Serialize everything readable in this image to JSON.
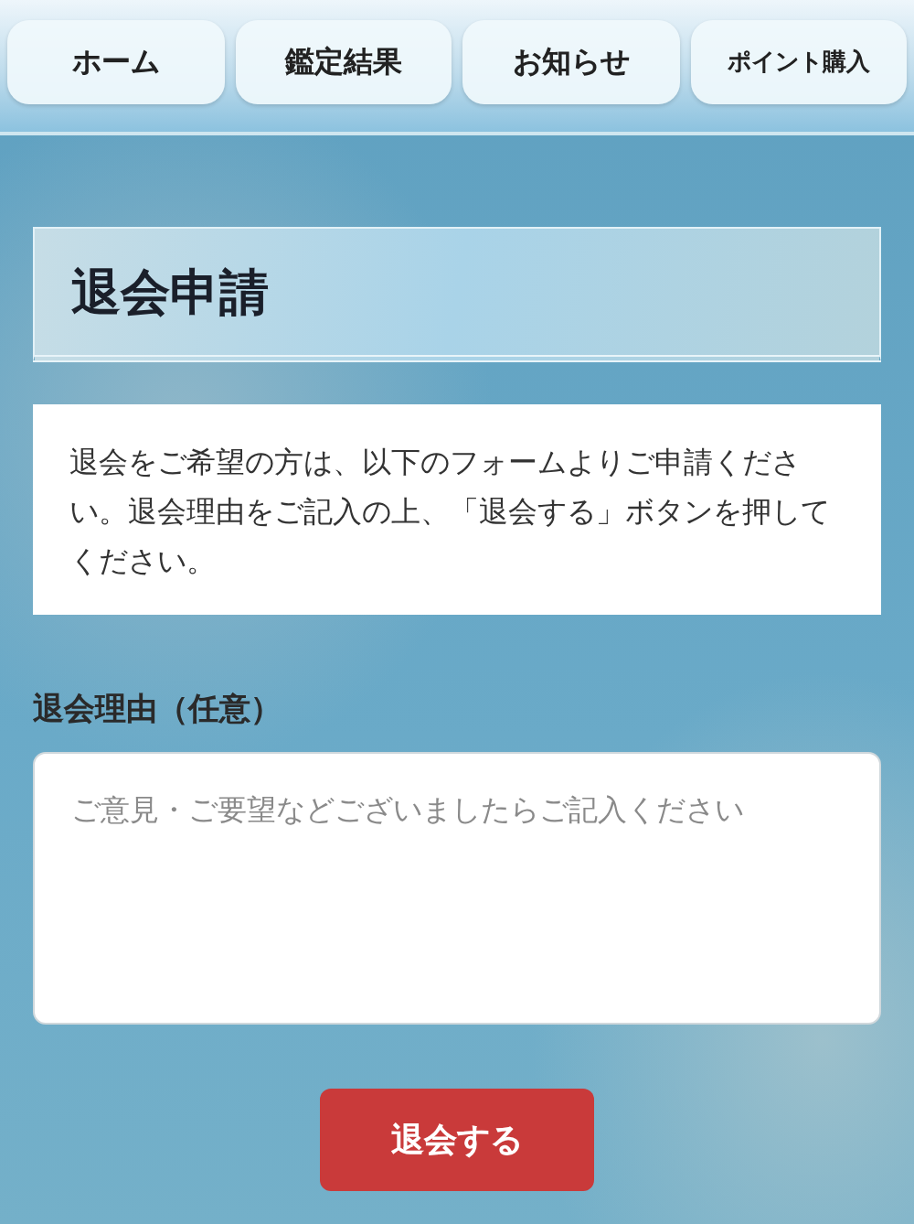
{
  "nav": [
    {
      "label": "ホーム"
    },
    {
      "label": "鑑定結果"
    },
    {
      "label": "お知らせ"
    },
    {
      "label": "ポイント購入"
    }
  ],
  "page_title": "退会申請",
  "intro": "退会をご希望の方は、以下のフォームよりご申請ください。退会理由をご記入の上、「退会する」ボタンを押してください。",
  "reason": {
    "label": "退会理由（任意）",
    "placeholder": "ご意見・ご要望などございましたらご記入ください"
  },
  "submit": "退会する"
}
